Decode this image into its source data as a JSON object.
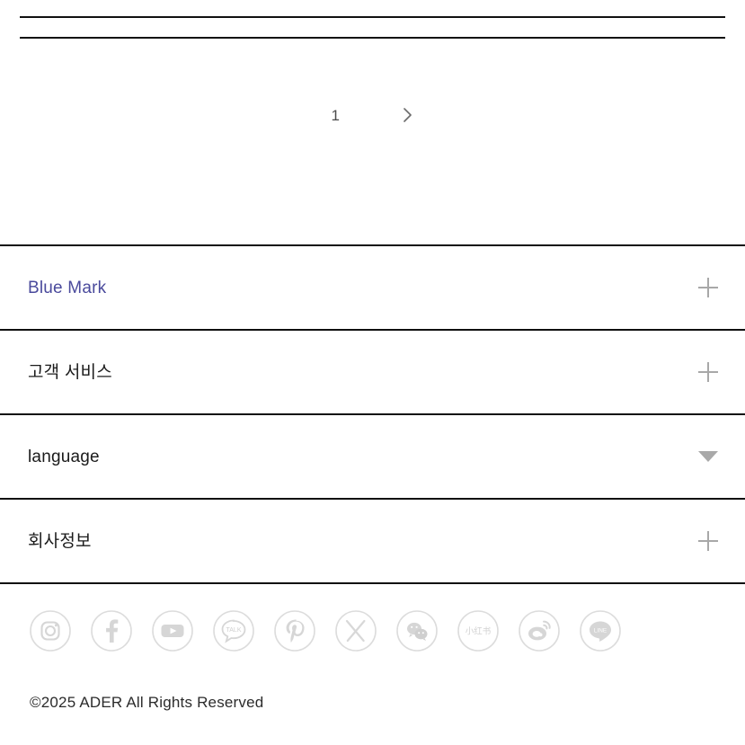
{
  "colors": {
    "rule": "#101010",
    "accent_blue": "#4a4a9c",
    "icon_gray": "#d9d9d9",
    "control_gray": "#a8a8a8",
    "text": "#1b1b1b"
  },
  "pagination": {
    "current_page": "1",
    "next_label": "next-page",
    "next_icon": "chevron-right-icon"
  },
  "footer": {
    "sections": [
      {
        "label": "Blue Mark",
        "control": "plus-icon",
        "accent": true
      },
      {
        "label": "고객 서비스",
        "control": "plus-icon",
        "accent": false
      },
      {
        "label": "language",
        "control": "caret-down-icon",
        "accent": false
      },
      {
        "label": "회사정보",
        "control": "plus-icon",
        "accent": false
      }
    ],
    "social": [
      {
        "name": "instagram-icon",
        "label": "Instagram"
      },
      {
        "name": "facebook-icon",
        "label": "Facebook"
      },
      {
        "name": "youtube-icon",
        "label": "YouTube"
      },
      {
        "name": "kakaotalk-icon",
        "label": "TALK"
      },
      {
        "name": "pinterest-icon",
        "label": "Pinterest"
      },
      {
        "name": "x-twitter-icon",
        "label": "X"
      },
      {
        "name": "wechat-icon",
        "label": "WeChat"
      },
      {
        "name": "xiaohongshu-icon",
        "label": "小红书"
      },
      {
        "name": "weibo-icon",
        "label": "Weibo"
      },
      {
        "name": "line-icon",
        "label": "LINE"
      }
    ],
    "copyright": "©2025 ADER All Rights Reserved"
  }
}
